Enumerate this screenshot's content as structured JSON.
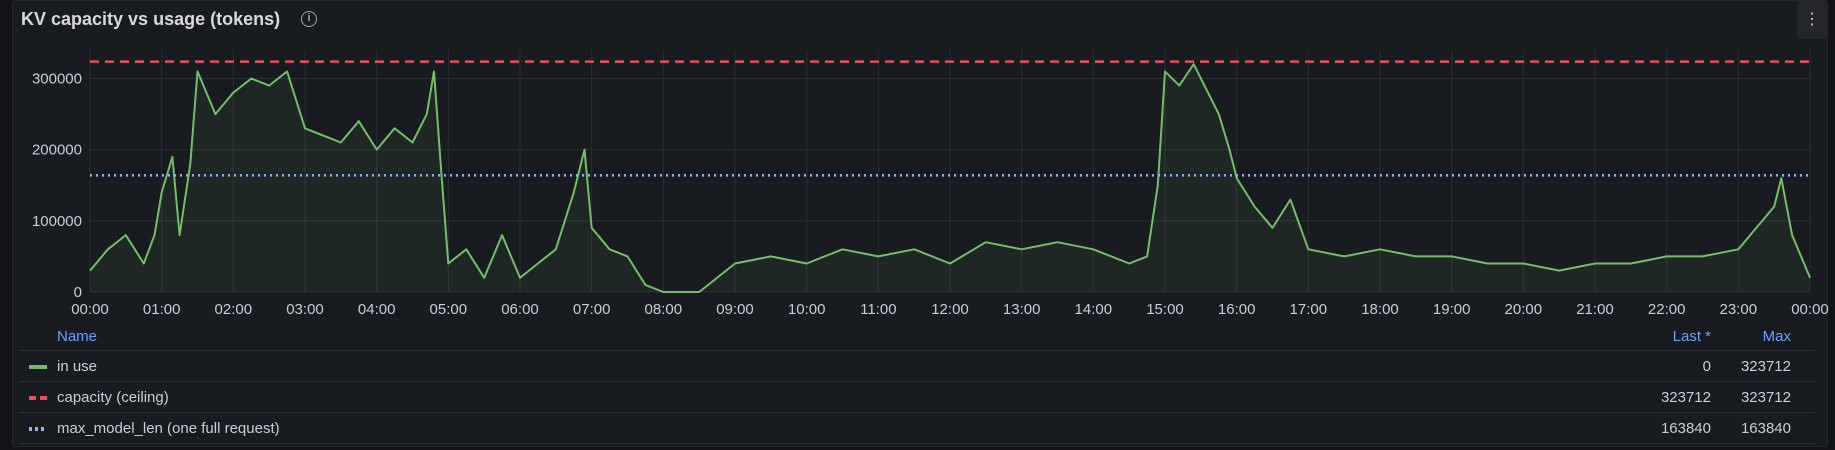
{
  "panel": {
    "title": "KV capacity vs usage (tokens)",
    "info_icon": "info-icon",
    "menu_icon": "kebab-menu-icon"
  },
  "legend": {
    "col_name": "Name",
    "col_last": "Last *",
    "col_max": "Max",
    "rows": [
      {
        "name": "in use",
        "last": "0",
        "max": "323712",
        "color": "#73bf69",
        "style": "solid"
      },
      {
        "name": "capacity (ceiling)",
        "last": "323712",
        "max": "323712",
        "color": "#f2495c",
        "style": "dashed"
      },
      {
        "name": "max_model_len (one full request)",
        "last": "163840",
        "max": "163840",
        "color": "#8ab8ff",
        "style": "dotted"
      }
    ]
  },
  "chart_data": {
    "type": "line",
    "x_ticks": [
      "00:00",
      "01:00",
      "02:00",
      "03:00",
      "04:00",
      "05:00",
      "06:00",
      "07:00",
      "08:00",
      "09:00",
      "10:00",
      "11:00",
      "12:00",
      "13:00",
      "14:00",
      "15:00",
      "16:00",
      "17:00",
      "18:00",
      "19:00",
      "20:00",
      "21:00",
      "22:00",
      "23:00",
      "00:00"
    ],
    "y_ticks": [
      0,
      100000,
      200000,
      300000
    ],
    "ylim": [
      0,
      340000
    ],
    "xlim_hours": [
      0,
      24
    ],
    "grid": true,
    "series": [
      {
        "name": "in use",
        "color": "#73bf69",
        "x": [
          0,
          0.25,
          0.5,
          0.75,
          0.9,
          1.0,
          1.15,
          1.25,
          1.4,
          1.5,
          1.75,
          2.0,
          2.25,
          2.5,
          2.75,
          3.0,
          3.25,
          3.5,
          3.75,
          4.0,
          4.25,
          4.5,
          4.7,
          4.8,
          4.9,
          5.0,
          5.25,
          5.5,
          5.75,
          6.0,
          6.25,
          6.5,
          6.75,
          6.9,
          7.0,
          7.25,
          7.5,
          7.75,
          8.0,
          8.5,
          9.0,
          9.5,
          10.0,
          10.5,
          11.0,
          11.5,
          12.0,
          12.5,
          13.0,
          13.5,
          14.0,
          14.5,
          14.75,
          14.9,
          15.0,
          15.2,
          15.4,
          15.6,
          15.75,
          15.9,
          16.0,
          16.25,
          16.5,
          16.75,
          17.0,
          17.5,
          18.0,
          18.5,
          19.0,
          19.5,
          20.0,
          20.5,
          21.0,
          21.5,
          22.0,
          22.5,
          23.0,
          23.25,
          23.5,
          23.6,
          23.75,
          24.0
        ],
        "values": [
          30000,
          60000,
          80000,
          40000,
          80000,
          140000,
          190000,
          80000,
          180000,
          310000,
          250000,
          280000,
          300000,
          290000,
          310000,
          230000,
          220000,
          210000,
          240000,
          200000,
          230000,
          210000,
          250000,
          310000,
          170000,
          40000,
          60000,
          20000,
          80000,
          20000,
          40000,
          60000,
          140000,
          200000,
          90000,
          60000,
          50000,
          10000,
          0,
          0,
          40000,
          50000,
          40000,
          60000,
          50000,
          60000,
          40000,
          70000,
          60000,
          70000,
          60000,
          40000,
          50000,
          150000,
          310000,
          290000,
          320000,
          280000,
          250000,
          200000,
          160000,
          120000,
          90000,
          130000,
          60000,
          50000,
          60000,
          50000,
          50000,
          40000,
          40000,
          30000,
          40000,
          40000,
          50000,
          50000,
          60000,
          90000,
          120000,
          160000,
          80000,
          20000
        ]
      },
      {
        "name": "capacity (ceiling)",
        "color": "#f2495c",
        "constant": 323712
      },
      {
        "name": "max_model_len (one full request)",
        "color": "#8ab8ff",
        "constant": 163840
      }
    ]
  }
}
